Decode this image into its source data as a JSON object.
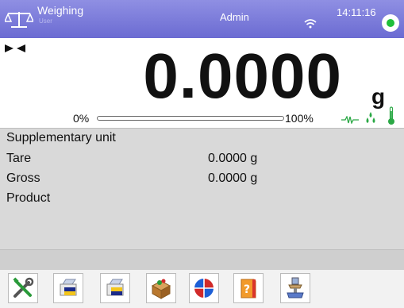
{
  "header": {
    "mode_title": "Weighing",
    "user_label": "User",
    "account": "Admin",
    "time": "14:11:16"
  },
  "display": {
    "weight": "0.0000",
    "unit": "g",
    "range_min_label": "0%",
    "range_max_label": "100%",
    "load_fraction": 0
  },
  "info": {
    "rows": [
      {
        "label": "Supplementary unit",
        "value": ""
      },
      {
        "label": "Tare",
        "value": "0.0000 g"
      },
      {
        "label": "Gross",
        "value": "0.0000 g"
      },
      {
        "label": "Product",
        "value": ""
      }
    ]
  },
  "toolbar": {
    "buttons": [
      "tools-icon",
      "print-header-icon",
      "print-footer-icon",
      "product-database-icon",
      "pie-chart-icon",
      "help-icon",
      "tare-icon"
    ]
  },
  "colors": {
    "header": "#7b7bdb",
    "status_ok": "#1fbf3a",
    "info_panel": "#d9d9d9"
  }
}
